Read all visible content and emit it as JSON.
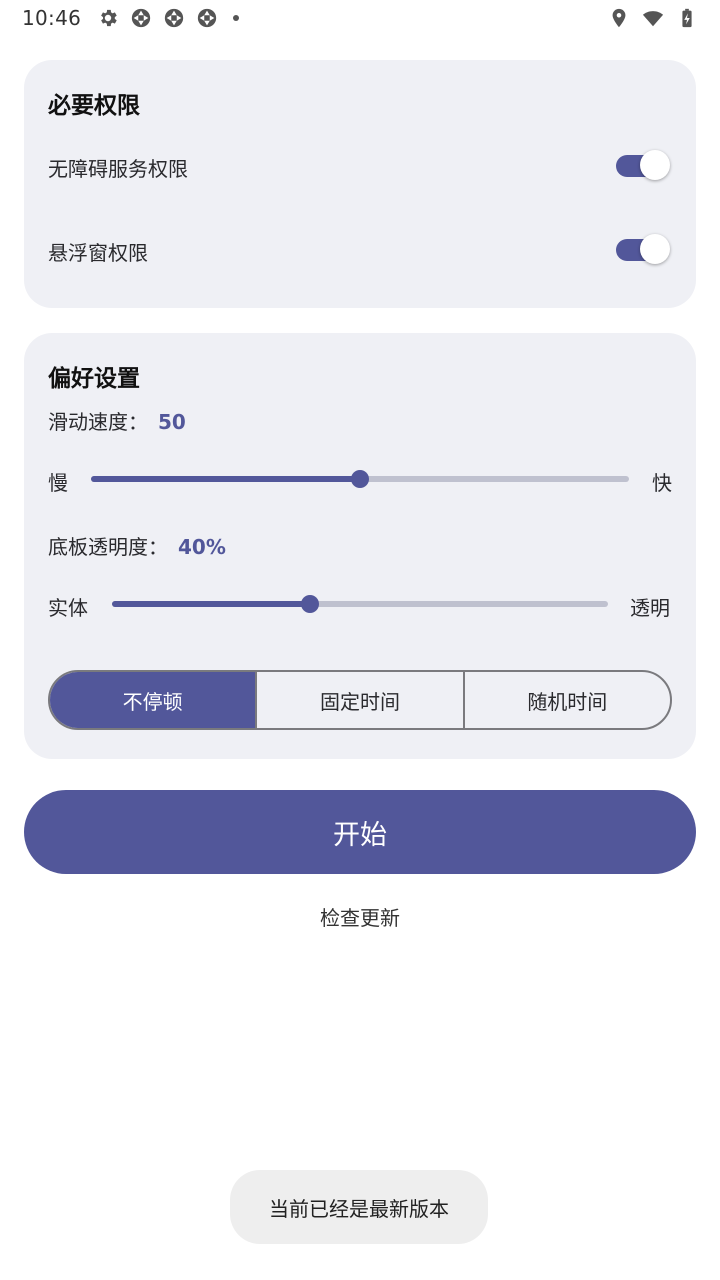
{
  "status_bar": {
    "time": "10:46",
    "icons": [
      "gear-icon",
      "app-aperture-icon",
      "app-aperture-icon",
      "app-aperture-icon",
      "notification-dot",
      "location-icon",
      "wifi-icon",
      "battery-charging-icon"
    ]
  },
  "permissions": {
    "title": "必要权限",
    "items": [
      {
        "label": "无障碍服务权限",
        "enabled": true
      },
      {
        "label": "悬浮窗权限",
        "enabled": true
      }
    ]
  },
  "preferences": {
    "title": "偏好设置",
    "scroll_speed": {
      "label": "滑动速度：",
      "value": "50",
      "fraction": 0.5,
      "min_label": "慢",
      "max_label": "快"
    },
    "opacity": {
      "label": "底板透明度：",
      "value": "40%",
      "fraction": 0.4,
      "min_label": "实体",
      "max_label": "透明"
    },
    "pause_modes": {
      "options": [
        "不停顿",
        "固定时间",
        "随机时间"
      ],
      "selected": "不停顿"
    }
  },
  "actions": {
    "start_label": "开始",
    "check_update_label": "检查更新"
  },
  "toast": {
    "message": "当前已经是最新版本"
  },
  "colors": {
    "accent": "#52579a",
    "card_bg": "#eff0f5",
    "track_inactive": "#bfc1cf"
  }
}
